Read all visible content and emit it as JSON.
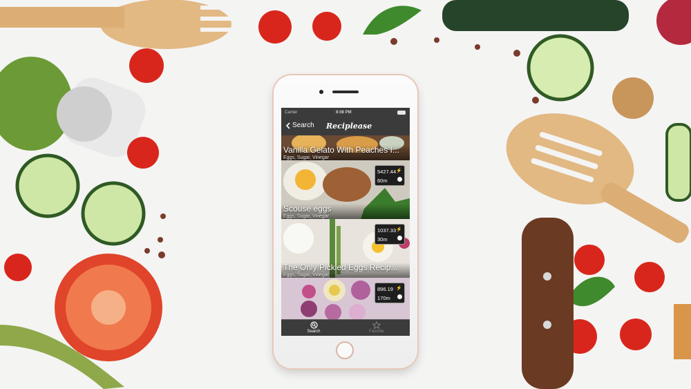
{
  "device": {
    "status_bar": {
      "carrier": "Carrier",
      "time": "8:08 PM"
    }
  },
  "nav": {
    "back_label": "Search",
    "title": "Reciplease"
  },
  "recipes": [
    {
      "title": "Vanilla Gelato With Peaches I...",
      "ingredients": "Eggs, Sugar, Vinegar"
    },
    {
      "title": "Scouse eggs",
      "ingredients": "Eggs, Sugar, Vinegar",
      "likes": "5427.44",
      "duration": "60m"
    },
    {
      "title": "The Only Pickled Eggs Recip...",
      "ingredients": "Eggs, Sugar, Vinegar",
      "likes": "1037.33",
      "duration": "30m"
    },
    {
      "title": "",
      "ingredients": "",
      "likes": "896.19",
      "duration": "170m"
    }
  ],
  "tabs": [
    {
      "label": "Search",
      "icon": "search-icon",
      "active": true
    },
    {
      "label": "Favorite",
      "icon": "star-icon",
      "active": false
    }
  ],
  "colors": {
    "screen_bg": "#3b3b3b",
    "badge_bg": "#1e1e1e",
    "tab_active": "#ffffff",
    "tab_inactive": "#8a8a8a"
  }
}
